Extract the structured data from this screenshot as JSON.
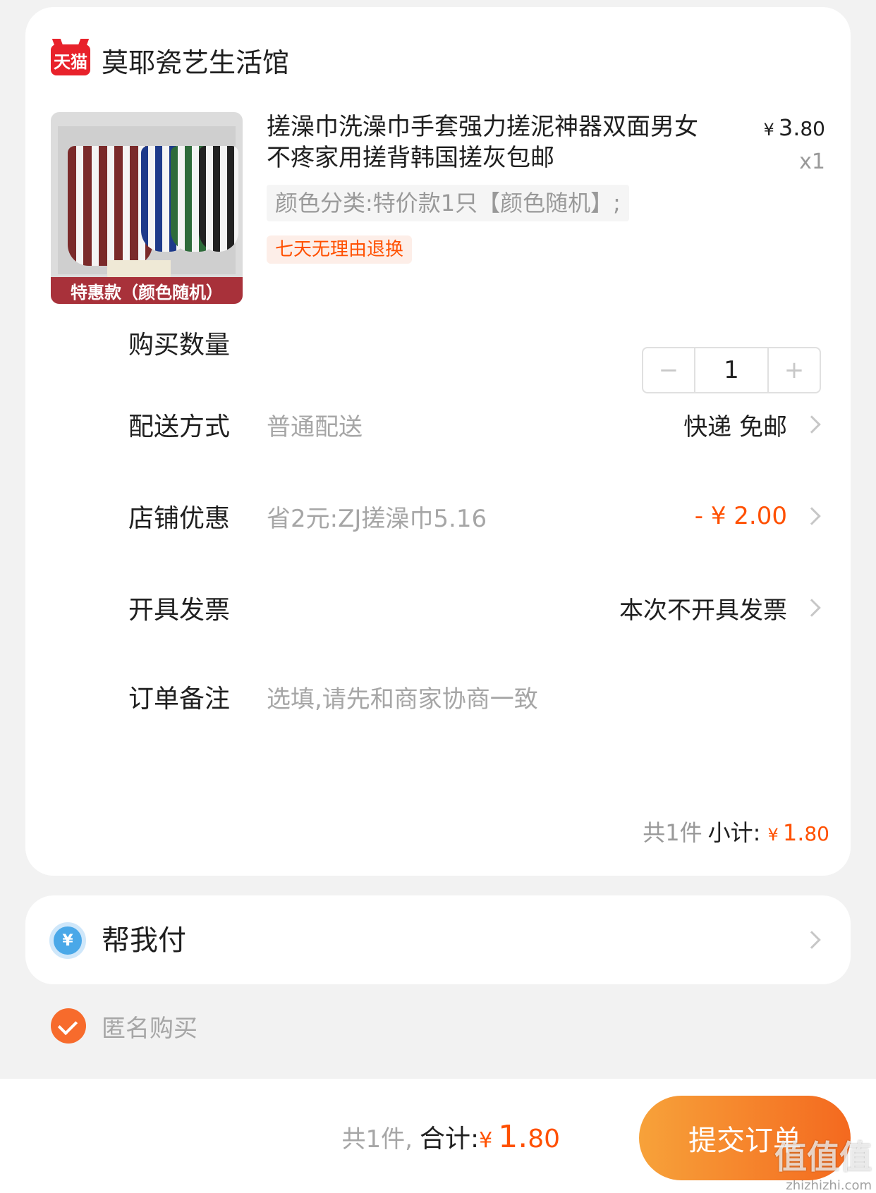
{
  "shop": {
    "logo_text": "天猫",
    "name": "莫耶瓷艺生活馆"
  },
  "product": {
    "title": "搓澡巾洗澡巾手套强力搓泥神器双面男女不疼家用搓背韩国搓灰包邮",
    "price_symbol": "¥",
    "price_int": "3.",
    "price_dec": "80",
    "quantity_label": "x1",
    "sku": "颜色分类:特价款1只【颜色随机】;",
    "return_tag": "七天无理由退换",
    "thumb_banner": "特惠款（颜色随机）"
  },
  "quantity_row": {
    "label": "购买数量",
    "minus": "−",
    "value": "1",
    "plus": "+"
  },
  "delivery_row": {
    "label": "配送方式",
    "sub": "普通配送",
    "value": "快递 免邮"
  },
  "coupon_row": {
    "label": "店铺优惠",
    "sub": "省2元:ZJ搓澡巾5.16",
    "value": "- ¥ 2.00"
  },
  "invoice_row": {
    "label": "开具发票",
    "value": "本次不开具发票"
  },
  "note_row": {
    "label": "订单备注",
    "placeholder": "选填,请先和商家协商一致"
  },
  "subtotal": {
    "count_text": "共1件",
    "label": "小计:",
    "yen": "¥",
    "int": "1.",
    "dec": "80"
  },
  "helper": {
    "icon_text": "¥",
    "label": "帮我付"
  },
  "anonymous": {
    "label": "匿名购买",
    "checked": true
  },
  "bottom": {
    "count_text": "共1件,",
    "label": "合计:",
    "yen": "¥",
    "int": "1.",
    "dec": "80",
    "submit_label": "提交订单"
  },
  "watermark": {
    "text": "值值值",
    "url": "zhizhizhi.com"
  },
  "colors": {
    "accent": "#ff5000",
    "button_start": "#f7a23a",
    "button_end": "#f4691f",
    "tmall_red": "#e8222b"
  }
}
